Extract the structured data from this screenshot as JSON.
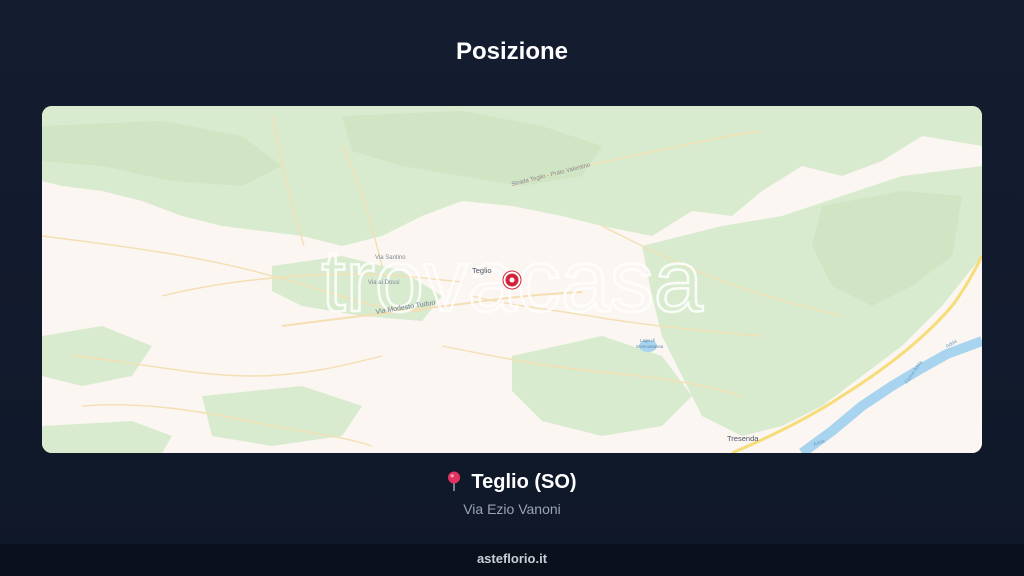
{
  "page": {
    "title": "Posizione"
  },
  "map": {
    "watermark": "trovacasa",
    "labels": {
      "strada": "Strada Teglio - Prato Valentino",
      "via_santino": "Via Santino",
      "via_dossi": "Via ai Dossi",
      "via_tudori": "Via Modesto Tudori",
      "town": "Teglio",
      "lake_line1": "Lago di",
      "lake_line2": "Sommasassa",
      "tresenda": "Tresenda",
      "river1": "Adda",
      "river2": "Fiume Adda",
      "river3": "Adda"
    },
    "colors": {
      "land": "#fbf6f1",
      "forest": "#d9ebcf",
      "forest_dark": "#cfe5c3",
      "road": "#f3dfb3",
      "main_road": "#f7dc7a",
      "water": "#a9d4ef",
      "marker": "#d1233a"
    },
    "marker_icon": "map-pin-icon"
  },
  "location": {
    "pin_icon": "map-pin-icon",
    "city": "Teglio (SO)",
    "address": "Via Ezio Vanoni"
  },
  "footer": {
    "site": "asteflorio.it"
  }
}
